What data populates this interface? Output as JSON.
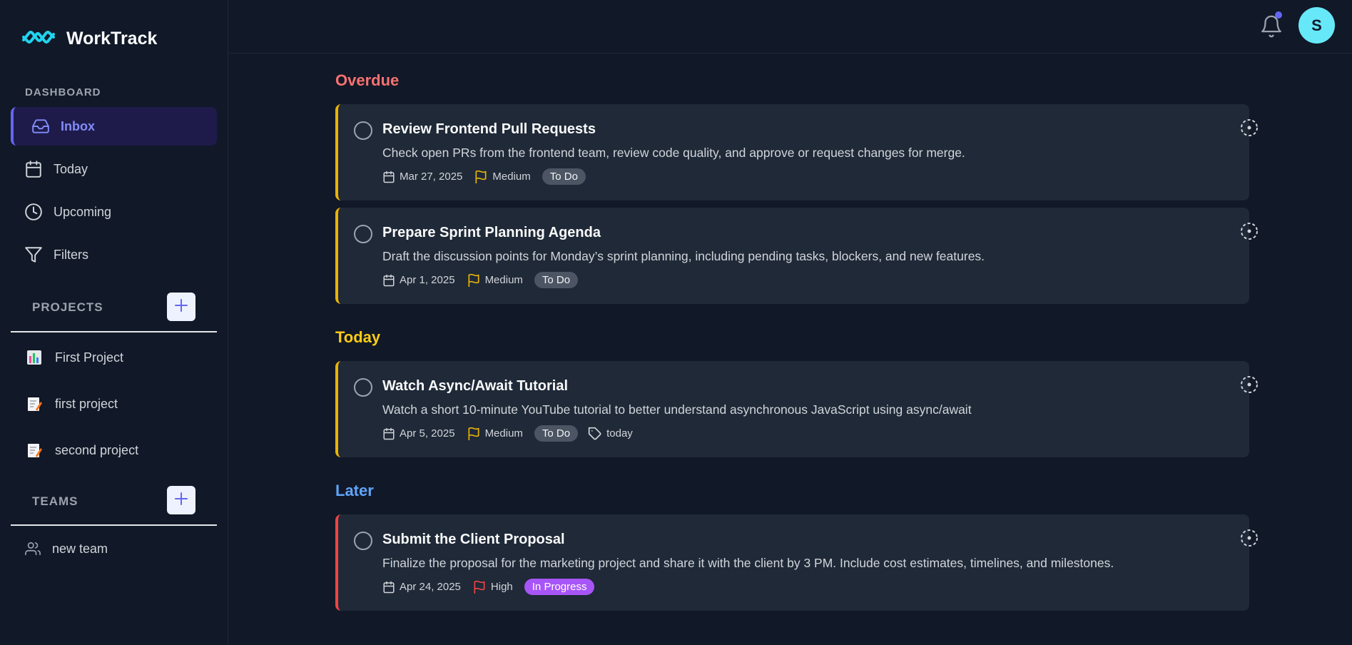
{
  "app": {
    "name": "WorkTrack"
  },
  "sidebar": {
    "dashboard_label": "DASHBOARD",
    "nav": [
      {
        "label": "Inbox",
        "icon": "inbox-icon",
        "active": true
      },
      {
        "label": "Today",
        "icon": "calendar-icon"
      },
      {
        "label": "Upcoming",
        "icon": "clock-icon"
      },
      {
        "label": "Filters",
        "icon": "filter-icon"
      }
    ],
    "projects_label": "PROJECTS",
    "projects": [
      {
        "label": "First Project",
        "icon": "bar-chart-emoji-icon"
      },
      {
        "label": "first project",
        "icon": "memo-emoji-icon"
      },
      {
        "label": "second project",
        "icon": "memo-emoji-icon"
      }
    ],
    "teams_label": "TEAMS",
    "teams": [
      {
        "label": "new team",
        "icon": "users-icon"
      }
    ]
  },
  "header": {
    "avatar_initial": "S"
  },
  "groups": {
    "overdue": {
      "title": "Overdue",
      "color": "#f87171"
    },
    "today": {
      "title": "Today",
      "color": "#facc15"
    },
    "later": {
      "title": "Later",
      "color": "#60a5fa"
    }
  },
  "tasks": [
    {
      "title": "Review Frontend Pull Requests",
      "description": "Check open PRs from the frontend team, review code quality, and approve or request changes for merge.",
      "date": "Mar 27, 2025",
      "priority": "Medium",
      "status": "To Do"
    },
    {
      "title": "Prepare Sprint Planning Agenda",
      "description": "Draft the discussion points for Monday’s sprint planning, including pending tasks, blockers, and new features.",
      "date": "Apr 1, 2025",
      "priority": "Medium",
      "status": "To Do"
    },
    {
      "title": "Watch Async/Await Tutorial",
      "description": "Watch a short 10-minute YouTube tutorial to better understand asynchronous JavaScript using async/await",
      "date": "Apr 5, 2025",
      "priority": "Medium",
      "status": "To Do",
      "tag": "today"
    },
    {
      "title": "Submit the Client Proposal",
      "description": "Finalize the proposal for the marketing project and share it with the client by 3 PM. Include cost estimates, timelines, and milestones.",
      "date": "Apr 24, 2025",
      "priority": "High",
      "status": "In Progress"
    }
  ],
  "colors": {
    "accent": "#6366f1",
    "medium_priority": "#eab308",
    "high_priority": "#ef4444",
    "in_progress": "#a855f7"
  }
}
